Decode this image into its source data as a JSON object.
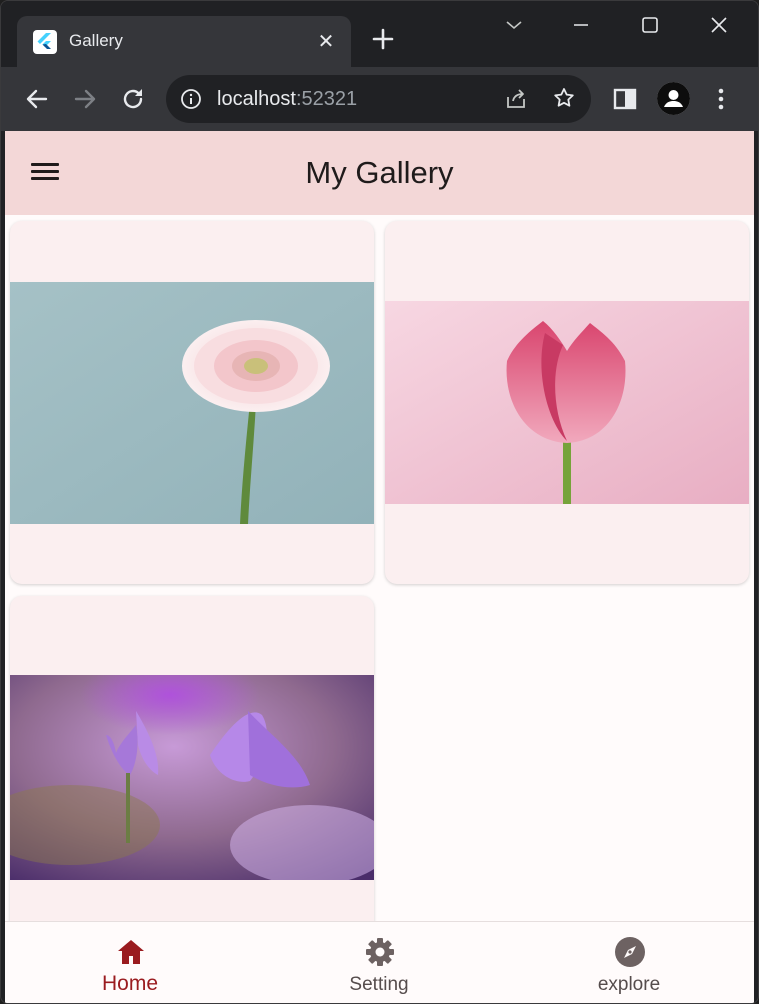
{
  "browser": {
    "tab_title": "Gallery",
    "url_host": "localhost",
    "url_port": ":52321"
  },
  "app": {
    "title": "My Gallery",
    "accent_color": "#9a1b1f",
    "appbar_color": "#f3d7d7"
  },
  "gallery": {
    "items": [
      {
        "subject": "pink gerbera daisy on blue background"
      },
      {
        "subject": "pink tulip on pink background"
      },
      {
        "subject": "purple crocus flowers"
      }
    ]
  },
  "bottom_nav": {
    "items": [
      {
        "label": "Home",
        "icon": "home-icon",
        "active": true
      },
      {
        "label": "Setting",
        "icon": "gear-icon",
        "active": false
      },
      {
        "label": "explore",
        "icon": "compass-icon",
        "active": false
      }
    ]
  }
}
